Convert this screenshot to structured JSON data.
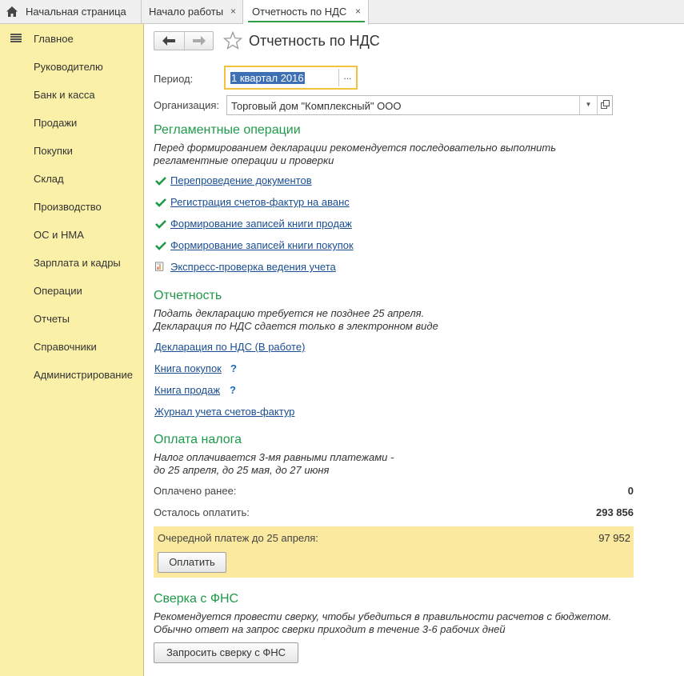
{
  "tabs": {
    "home": "Начальная страница",
    "start": "Начало работы",
    "current": "Отчетность по НДС",
    "close_glyph": "×"
  },
  "sidebar": {
    "items": [
      {
        "label": "Главное"
      },
      {
        "label": "Руководителю"
      },
      {
        "label": "Банк и касса"
      },
      {
        "label": "Продажи"
      },
      {
        "label": "Покупки"
      },
      {
        "label": "Склад"
      },
      {
        "label": "Производство"
      },
      {
        "label": "ОС и НМА"
      },
      {
        "label": "Зарплата и кадры"
      },
      {
        "label": "Операции"
      },
      {
        "label": "Отчеты"
      },
      {
        "label": "Справочники"
      },
      {
        "label": "Администрирование"
      }
    ]
  },
  "page": {
    "title": "Отчетность по НДС",
    "period_label": "Период:",
    "period_value": "1 квартал 2016",
    "period_button": "...",
    "org_label": "Организация:",
    "org_value": "Торговый дом \"Комплексный\" ООО"
  },
  "regl": {
    "heading": "Регламентные операции",
    "note_1": "Перед формированием декларации рекомендуется последовательно выполнить",
    "note_2": "регламентные операции и проверки",
    "ops": [
      {
        "label": "Перепроведение документов",
        "status": "done"
      },
      {
        "label": "Регистрация счетов-фактур на аванс",
        "status": "done"
      },
      {
        "label": "Формирование записей книги продаж",
        "status": "done"
      },
      {
        "label": "Формирование записей книги покупок",
        "status": "done"
      },
      {
        "label": "Экспресс-проверка ведения учета",
        "status": "report"
      }
    ]
  },
  "report": {
    "heading": "Отчетность",
    "note_1": "Подать декларацию требуется не позднее 25 апреля.",
    "note_2": "Декларация по НДС сдается только в электронном виде",
    "link_declaration": "Декларация по НДС (В работе)",
    "link_purchases": "Книга покупок",
    "link_sales": "Книга продаж",
    "link_journal": "Журнал учета счетов-фактур",
    "help_glyph": "?"
  },
  "payment": {
    "heading": "Оплата налога",
    "note_1": "Налог оплачивается 3-мя равными платежами -",
    "note_2": "до 25 апреля, до 25 мая, до 27 июня",
    "paid_label": "Оплачено ранее:",
    "paid_value": "0",
    "remaining_label": "Осталось оплатить:",
    "remaining_value": "293 856",
    "next_label": "Очередной платеж до 25 апреля:",
    "next_value": "97 952",
    "pay_button": "Оплатить"
  },
  "fns": {
    "heading": "Сверка с ФНС",
    "note_1": "Рекомендуется провести сверку, чтобы убедиться в правильности расчетов с бюджетом.",
    "note_2": "Обычно ответ на запрос сверки приходит в течение 3-6 рабочих дней",
    "button": "Запросить сверку с ФНС"
  },
  "colors": {
    "accent_green": "#1f9a4a",
    "sidebar_bg": "#fbf0a8",
    "link": "#1a4e92",
    "highlight_bg": "#fbe9a0"
  }
}
